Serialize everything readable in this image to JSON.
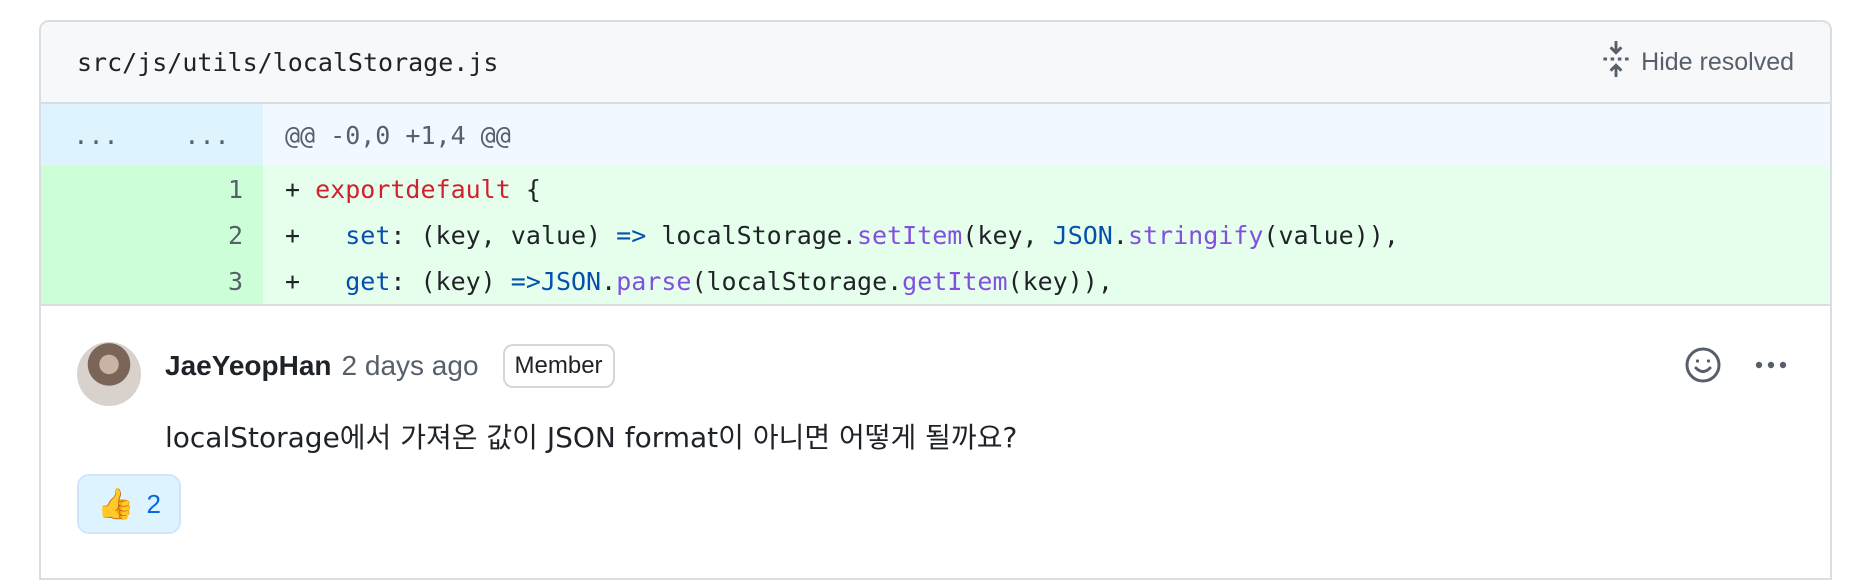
{
  "file": {
    "path": "src/js/utils/localStorage.js",
    "hide_resolved_label": "Hide resolved"
  },
  "diff": {
    "hunk": {
      "old_num": "...",
      "new_num": "...",
      "header": "@@ -0,0 +1,4 @@"
    },
    "lines": [
      {
        "num": "1"
      },
      {
        "num": "2"
      },
      {
        "num": "3"
      }
    ]
  },
  "comment": {
    "author": "JaeYeopHan",
    "time": "2 days ago",
    "badge": "Member",
    "body": "localStorage에서 가져온 값이 JSON format이 아니면 어떻게 될까요?",
    "reaction": {
      "emoji": "👍",
      "count": "2"
    }
  },
  "colors": {
    "hunk_bg": "#ddf4ff",
    "add_num_bg": "#ccffd8",
    "add_code_bg": "#e6ffec",
    "keyword": "#cf222e",
    "function": "#8250df",
    "constant": "#0550ae",
    "link": "#0969da"
  },
  "icons": [
    "unfold-icon",
    "smiley-icon",
    "kebab-horizontal-icon",
    "thumbs-up-icon"
  ]
}
